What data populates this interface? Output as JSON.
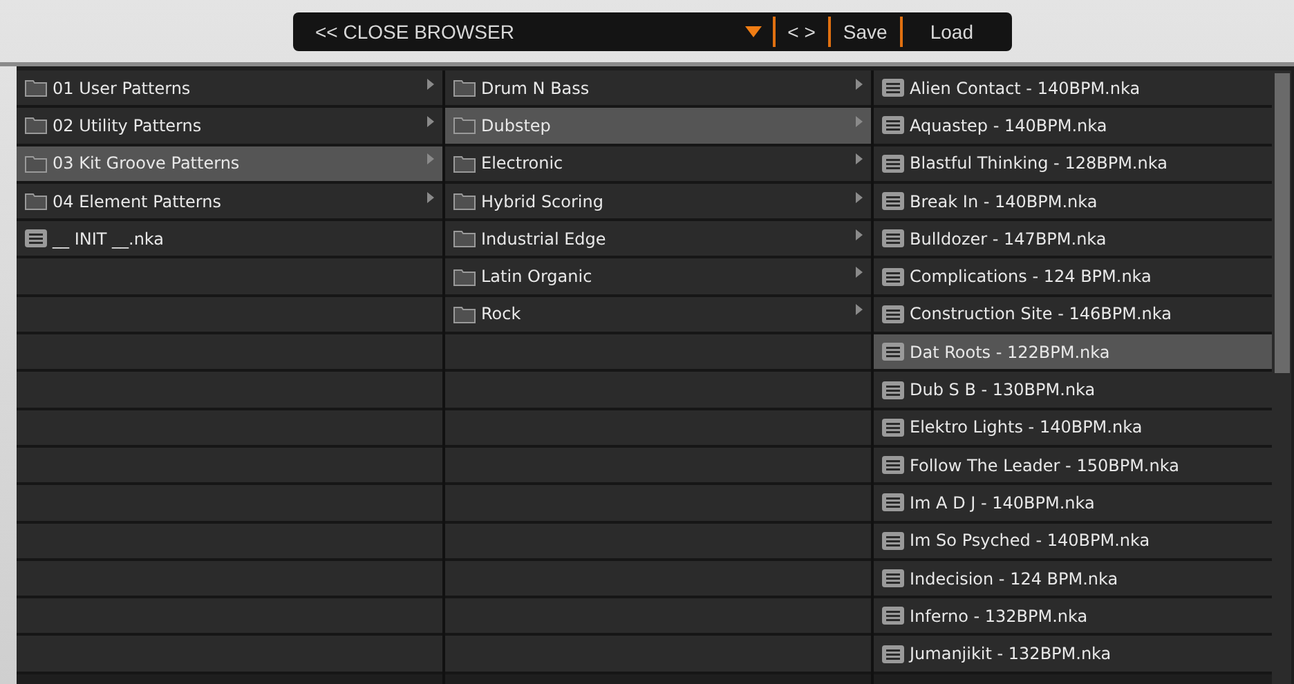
{
  "toolbar": {
    "close_label": "<< CLOSE BROWSER",
    "prev_next": "< >",
    "save": "Save",
    "load": "Load"
  },
  "columns": [
    {
      "items": [
        {
          "kind": "folder",
          "label": "01 User Patterns",
          "selected": false
        },
        {
          "kind": "folder",
          "label": "02 Utility Patterns",
          "selected": false
        },
        {
          "kind": "folder",
          "label": "03 Kit Groove Patterns",
          "selected": true
        },
        {
          "kind": "folder",
          "label": "04 Element Patterns",
          "selected": false
        },
        {
          "kind": "file",
          "label": "__ INIT __.nka",
          "selected": false
        }
      ]
    },
    {
      "items": [
        {
          "kind": "folder",
          "label": "Drum N Bass",
          "selected": false
        },
        {
          "kind": "folder",
          "label": "Dubstep",
          "selected": true
        },
        {
          "kind": "folder",
          "label": "Electronic",
          "selected": false
        },
        {
          "kind": "folder",
          "label": "Hybrid Scoring",
          "selected": false
        },
        {
          "kind": "folder",
          "label": "Industrial Edge",
          "selected": false
        },
        {
          "kind": "folder",
          "label": "Latin Organic",
          "selected": false
        },
        {
          "kind": "folder",
          "label": "Rock",
          "selected": false
        }
      ]
    },
    {
      "items": [
        {
          "kind": "file",
          "label": "Alien Contact - 140BPM.nka",
          "selected": false
        },
        {
          "kind": "file",
          "label": "Aquastep - 140BPM.nka",
          "selected": false
        },
        {
          "kind": "file",
          "label": "Blastful Thinking - 128BPM.nka",
          "selected": false
        },
        {
          "kind": "file",
          "label": "Break In - 140BPM.nka",
          "selected": false
        },
        {
          "kind": "file",
          "label": "Bulldozer - 147BPM.nka",
          "selected": false
        },
        {
          "kind": "file",
          "label": "Complications - 124 BPM.nka",
          "selected": false
        },
        {
          "kind": "file",
          "label": "Construction Site - 146BPM.nka",
          "selected": false
        },
        {
          "kind": "file",
          "label": "Dat Roots - 122BPM.nka",
          "selected": true
        },
        {
          "kind": "file",
          "label": "Dub S B - 130BPM.nka",
          "selected": false
        },
        {
          "kind": "file",
          "label": "Elektro Lights - 140BPM.nka",
          "selected": false
        },
        {
          "kind": "file",
          "label": "Follow The Leader - 150BPM.nka",
          "selected": false
        },
        {
          "kind": "file",
          "label": "Im A D J - 140BPM.nka",
          "selected": false
        },
        {
          "kind": "file",
          "label": "Im So Psyched - 140BPM.nka",
          "selected": false
        },
        {
          "kind": "file",
          "label": "Indecision - 124 BPM.nka",
          "selected": false
        },
        {
          "kind": "file",
          "label": "Inferno - 132BPM.nka",
          "selected": false
        },
        {
          "kind": "file",
          "label": "Jumanjikit - 132BPM.nka",
          "selected": false
        }
      ]
    }
  ]
}
